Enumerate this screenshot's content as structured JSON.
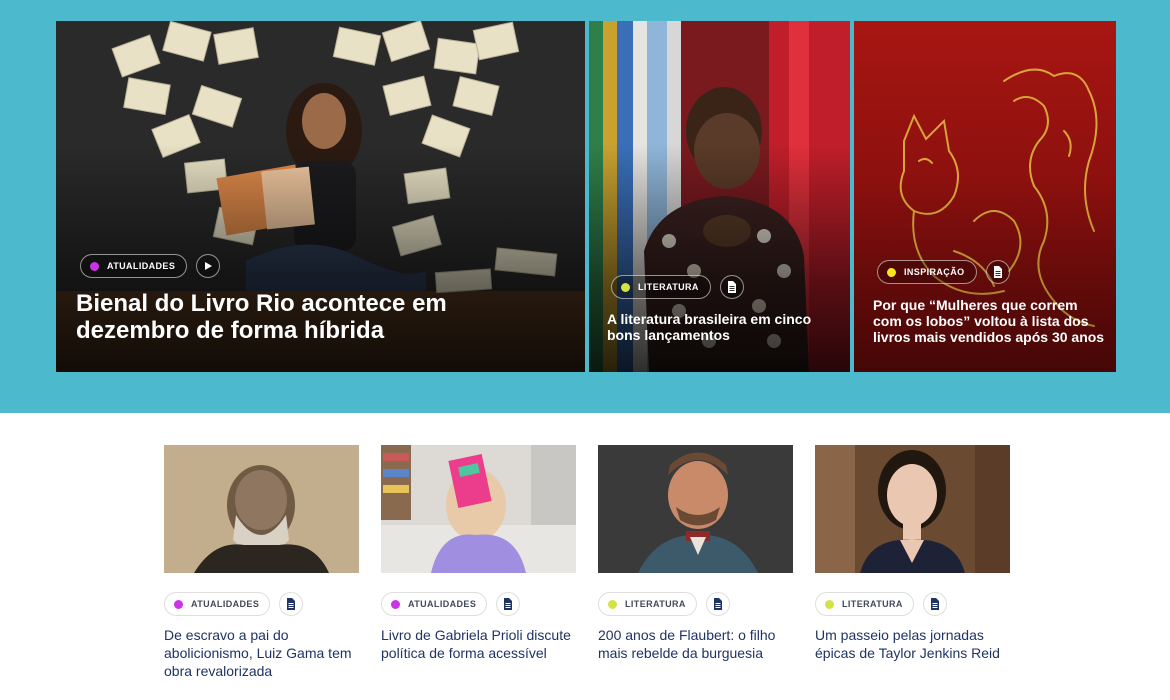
{
  "colors": {
    "band": "#4db9cc",
    "atualidades_dot": "#cc33e6",
    "literatura_dot": "#d4e246",
    "inspiracao_dot": "#f5e61c",
    "card_title": "#1f3364"
  },
  "featured": [
    {
      "category": "ATUALIDADES",
      "media_icon": "play-icon",
      "title": "Bienal do Livro Rio acontece em dezembro de forma híbrida"
    },
    {
      "category": "LITERATURA",
      "media_icon": "document-icon",
      "title": "A literatura brasileira em cinco bons lançamentos"
    },
    {
      "category": "INSPIRAÇÃO",
      "media_icon": "document-icon",
      "title": "Por que “Mulheres que correm com os lobos” voltou à lista dos livros mais vendidos após 30 anos"
    }
  ],
  "cards": [
    {
      "category": "ATUALIDADES",
      "media_icon": "document-icon",
      "title": "De escravo a pai do abolicionismo, Luiz Gama tem obra revalorizada"
    },
    {
      "category": "ATUALIDADES",
      "media_icon": "document-icon",
      "title": "Livro de Gabriela Prioli discute política de forma acessível"
    },
    {
      "category": "LITERATURA",
      "media_icon": "document-icon",
      "title": "200 anos de Flaubert: o filho mais rebelde da burguesia"
    },
    {
      "category": "LITERATURA",
      "media_icon": "document-icon",
      "title": "Um passeio pelas jornadas épicas de Taylor Jenkins Reid"
    }
  ]
}
